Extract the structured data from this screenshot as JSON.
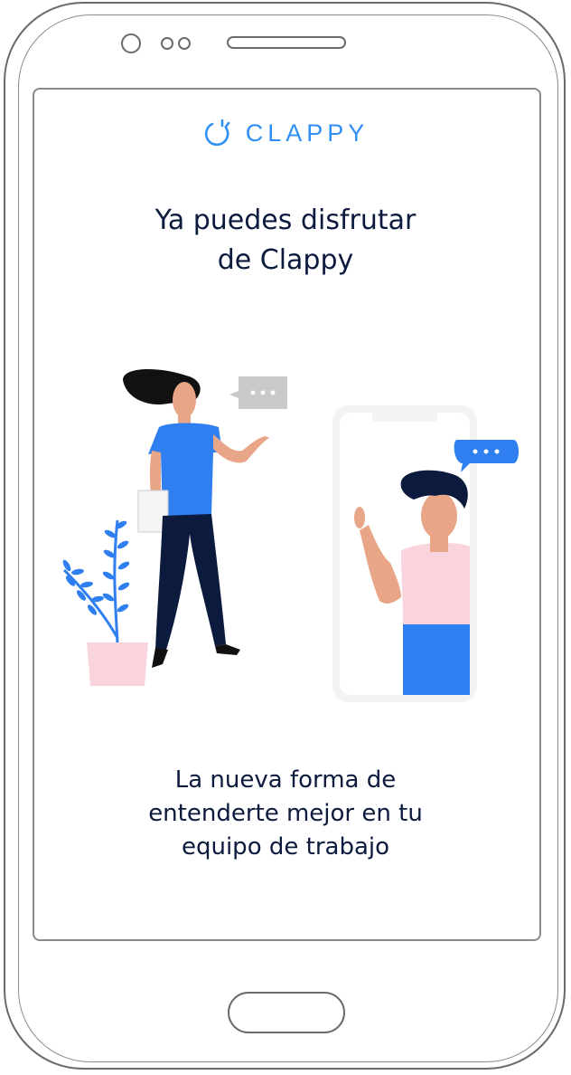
{
  "app": {
    "brand_name": "CLAPPY",
    "brand_color": "#2f8ff5",
    "text_color": "#0c1a3e"
  },
  "welcome": {
    "headline_line1": "Ya puedes disfrutar",
    "headline_line2": "de Clappy",
    "tagline_line1": "La nueva forma de",
    "tagline_line2": "entenderte mejor en tu",
    "tagline_line3": "equipo de trabajo"
  },
  "icons": {
    "logo": "clappy-logo-icon",
    "speech_bubble_left": "speech-bubble-icon",
    "speech_bubble_right": "speech-bubble-icon"
  }
}
